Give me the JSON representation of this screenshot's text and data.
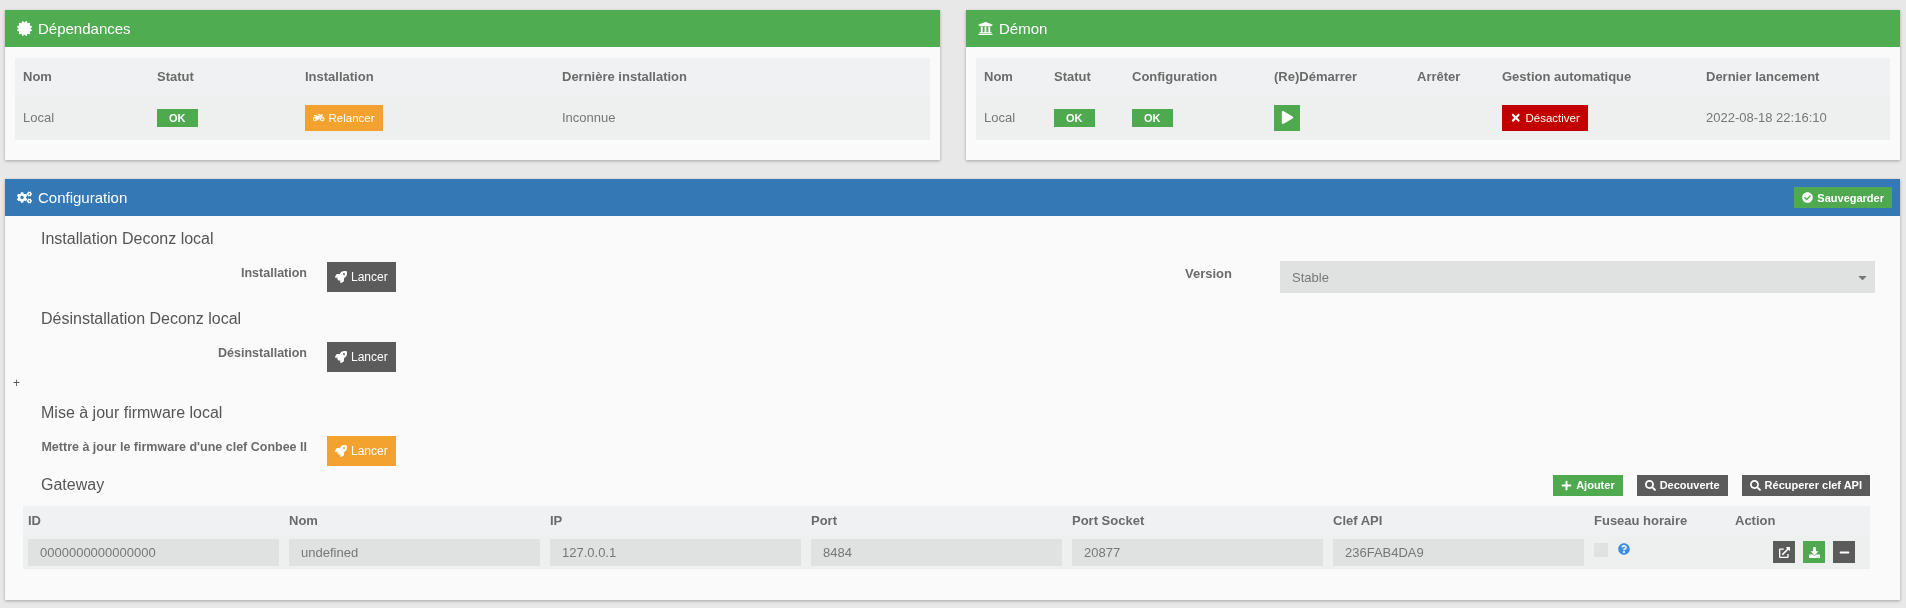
{
  "dependencies": {
    "title": "Dépendances",
    "columns": [
      "Nom",
      "Statut",
      "Installation",
      "Dernière installation"
    ],
    "row": {
      "name": "Local",
      "status": "OK",
      "action": "Relancer",
      "last_install": "Inconnue"
    }
  },
  "daemon": {
    "title": "Démon",
    "columns": [
      "Nom",
      "Statut",
      "Configuration",
      "(Re)Démarrer",
      "Arrêter",
      "Gestion automatique",
      "Dernier lancement"
    ],
    "row": {
      "name": "Local",
      "status": "OK",
      "configuration": "OK",
      "auto_management": "Désactiver",
      "last_launch": "2022-08-18 22:16:10"
    }
  },
  "configuration": {
    "title": "Configuration",
    "save_button": "Sauvegarder",
    "sections": [
      {
        "title": "Installation Deconz local",
        "label": "Installation",
        "button": "Lancer",
        "kind": "dark",
        "field": {
          "label": "Version",
          "value": "Stable"
        }
      },
      {
        "title": "Désinstallation Deconz local",
        "label": "Désinstallation",
        "button": "Lancer",
        "kind": "dark"
      },
      {
        "prefix_mark": "+",
        "title": "Mise à jour firmware local",
        "label": "Mettre à jour le firmware d'une clef Conbee II",
        "button": "Lancer",
        "kind": "warning"
      }
    ],
    "gateway": {
      "title": "Gateway",
      "buttons": [
        {
          "label": "Ajouter",
          "kind": "add"
        },
        {
          "label": "Decouverte",
          "kind": "search"
        },
        {
          "label": "Récuperer clef API",
          "kind": "search"
        }
      ],
      "columns": [
        "ID",
        "Nom",
        "IP",
        "Port",
        "Port Socket",
        "Clef API",
        "Fuseau horaire",
        "Action"
      ],
      "rows": [
        {
          "id": "0000000000000000",
          "name": "undefined",
          "ip": "127.0.0.1",
          "port": "8484",
          "port_socket": "20877",
          "api_key": "236FAB4DA9",
          "timezone_checked": false
        }
      ]
    }
  }
}
